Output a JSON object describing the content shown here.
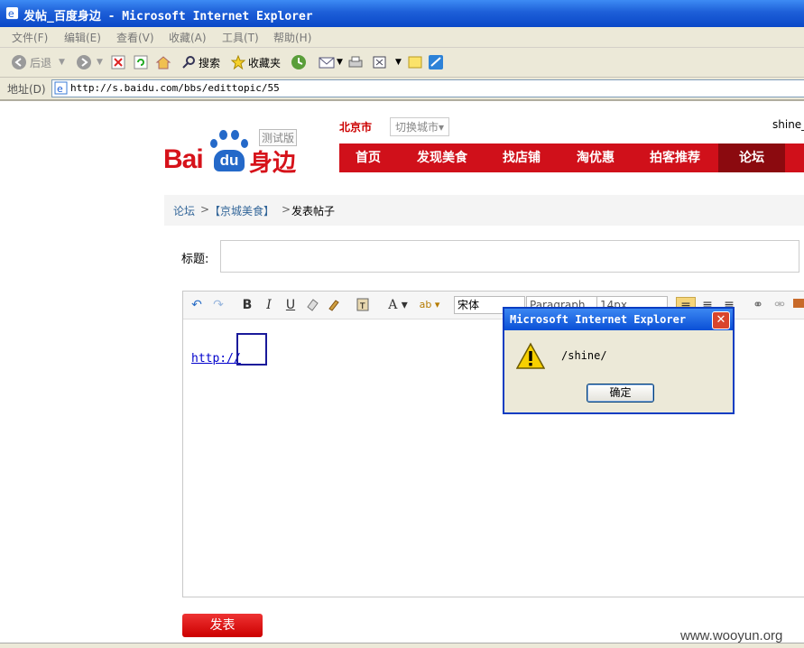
{
  "window": {
    "title": "发帖_百度身边 - Microsoft Internet Explorer"
  },
  "menu": [
    "文件(F)",
    "编辑(E)",
    "查看(V)",
    "收藏(A)",
    "工具(T)",
    "帮助(H)"
  ],
  "toolbar": {
    "back_label": "后退",
    "search_label": "搜索",
    "favorites_label": "收藏夹"
  },
  "address": {
    "label": "地址(D)",
    "url": "http://s.baidu.com/bbs/edittopic/55"
  },
  "site": {
    "logo_bai": "Bai",
    "logo_du": "du",
    "logo_sub": "身边",
    "badge": "测试版",
    "city": "北京市",
    "city_switch": "切换城市▾",
    "user": "shine_"
  },
  "nav": [
    "首页",
    "发现美食",
    "找店铺",
    "淘优惠",
    "拍客推荐",
    "论坛"
  ],
  "breadcrumb": {
    "root": "论坛",
    "sep1": ">",
    "board": "【京城美食】",
    "sep2": ">",
    "current": "发表帖子"
  },
  "form": {
    "title_label": "标题:",
    "title_value": ""
  },
  "editor": {
    "font": "宋体",
    "paragraph": "Paragraph",
    "size": "14px",
    "content_link": "http://"
  },
  "submit_label": "发表",
  "dialog": {
    "title": "Microsoft Internet Explorer",
    "message": "/shine/",
    "ok_label": "确定"
  },
  "watermark": "www.wooyun.org",
  "colors": {
    "brand_red": "#d0101a",
    "nav_active": "#8b0a0f",
    "baidu_blue": "#2469c9",
    "xp_blue": "#0a4fd6"
  }
}
